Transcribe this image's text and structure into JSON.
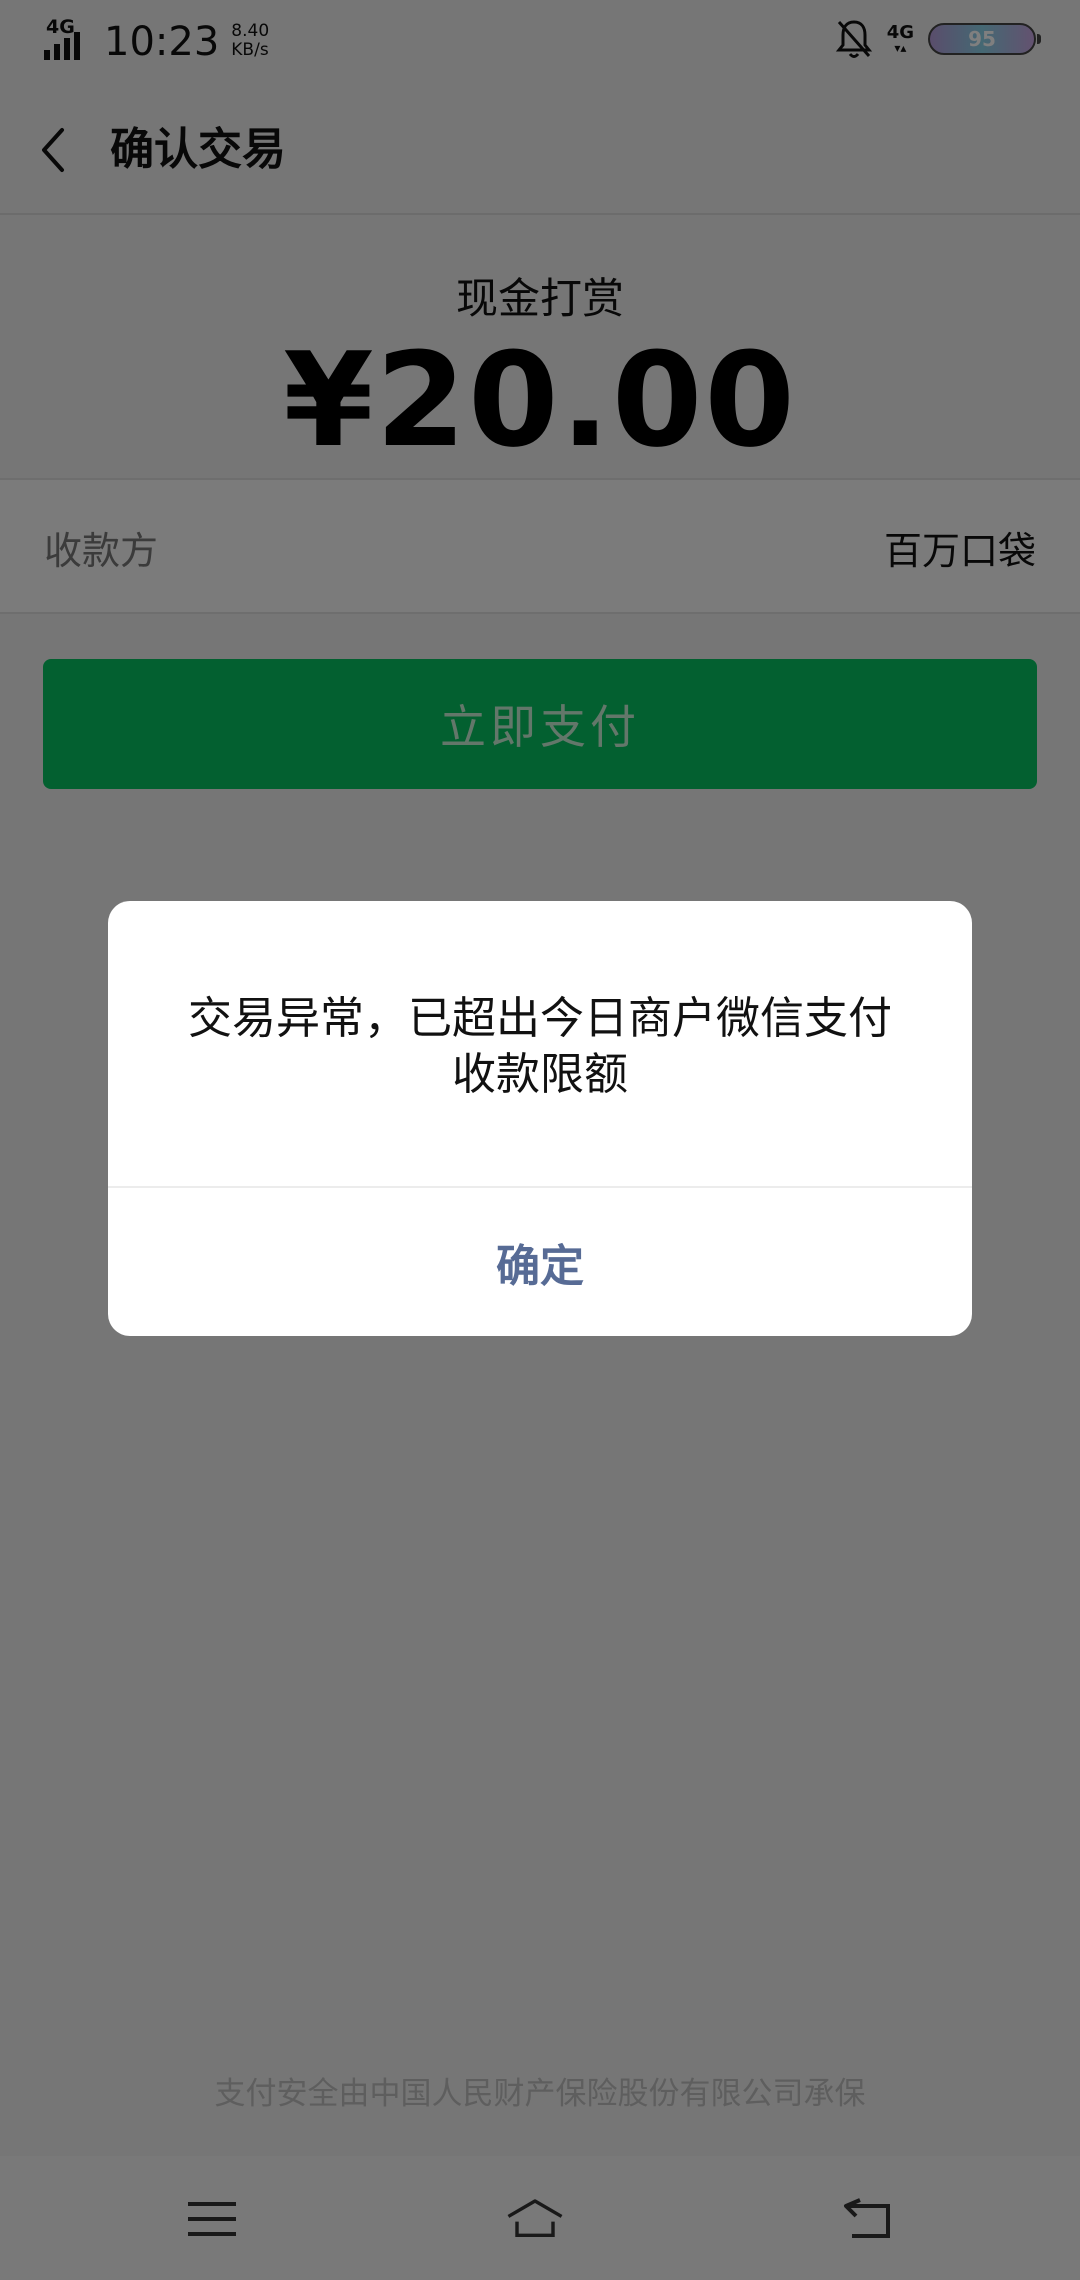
{
  "status_bar": {
    "network": "4G",
    "time": "10:23",
    "speed_value": "8.40",
    "speed_unit": "KB/s",
    "right_network": "4G",
    "battery": "95"
  },
  "header": {
    "title": "确认交易"
  },
  "amount": {
    "label": "现金打赏",
    "value": "¥20.00"
  },
  "payee": {
    "label": "收款方",
    "value": "百万口袋"
  },
  "pay_button": "立即支付",
  "footer_note": "支付安全由中国人民财产保险股份有限公司承保",
  "dialog": {
    "message": "交易异常，已超出今日商户微信支付收款限额",
    "confirm_label": "确定"
  },
  "colors": {
    "accent_green": "#07c160",
    "dialog_link": "#576b95"
  }
}
